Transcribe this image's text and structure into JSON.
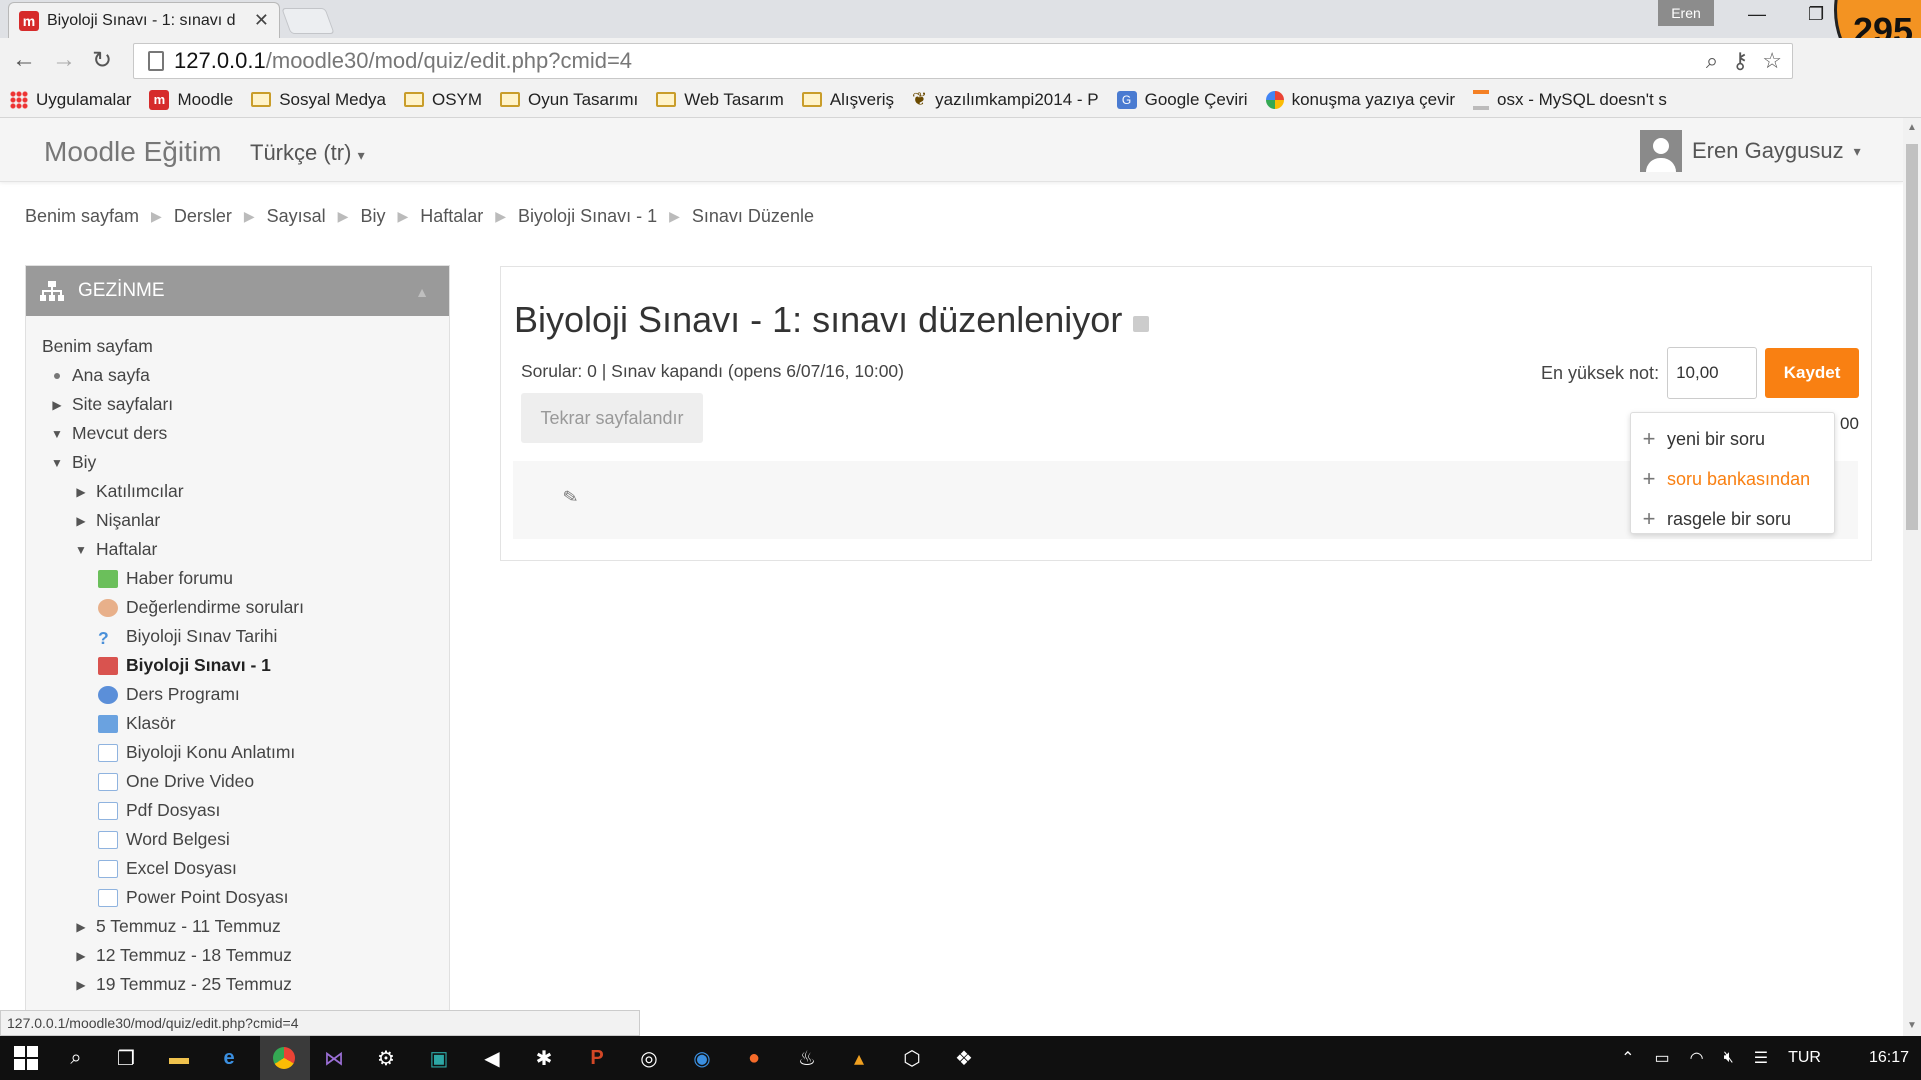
{
  "browser": {
    "tab_title": "Biyoloji Sınavı - 1: sınavı d",
    "tab_favicon": "m",
    "profile": "Eren",
    "counter": "295",
    "url_host": "127.0.0.1",
    "url_path": "/moodle30/mod/quiz/edit.php?cmid=4",
    "bookmarks": [
      {
        "label": "Uygulamalar",
        "icon": "apps-icon"
      },
      {
        "label": "Moodle",
        "icon": "moodle-icon"
      },
      {
        "label": "Sosyal Medya",
        "icon": "folder-icon"
      },
      {
        "label": "OSYM",
        "icon": "folder-icon"
      },
      {
        "label": "Oyun Tasarımı",
        "icon": "folder-icon"
      },
      {
        "label": "Web Tasarım",
        "icon": "folder-icon"
      },
      {
        "label": "Alışveriş",
        "icon": "folder-icon"
      },
      {
        "label": "yazılımkampi2014 - P",
        "icon": "bookmark-icon"
      },
      {
        "label": "Google Çeviri",
        "icon": "translate-icon"
      },
      {
        "label": "konuşma yazıya çevir",
        "icon": "chrome-icon"
      },
      {
        "label": "osx - MySQL doesn't s",
        "icon": "stackoverflow-icon"
      }
    ],
    "status_url": "127.0.0.1/moodle30/mod/quiz/edit.php?cmid=4"
  },
  "navbar": {
    "brand": "Moodle Eğitim",
    "language": "Türkçe (tr)",
    "user": "Eren Gaygusuz"
  },
  "breadcrumb": [
    "Benim sayfam",
    "Dersler",
    "Sayısal",
    "Biy",
    "Haftalar",
    "Biyoloji Sınavı - 1",
    "Sınavı Düzenle"
  ],
  "navigation": {
    "title": "GEZİNME",
    "items": [
      {
        "label": "Benim sayfam",
        "level": 0,
        "toggle": "",
        "icon": ""
      },
      {
        "label": "Ana sayfa",
        "level": 1,
        "toggle": "dot",
        "icon": ""
      },
      {
        "label": "Site sayfaları",
        "level": 1,
        "toggle": "▶",
        "icon": ""
      },
      {
        "label": "Mevcut ders",
        "level": 1,
        "toggle": "▼",
        "icon": ""
      },
      {
        "label": "Biy",
        "level": 2,
        "toggle": "▼",
        "icon": ""
      },
      {
        "label": "Katılımcılar",
        "level": 3,
        "toggle": "▶",
        "icon": ""
      },
      {
        "label": "Nişanlar",
        "level": 3,
        "toggle": "▶",
        "icon": ""
      },
      {
        "label": "Haftalar",
        "level": 3,
        "toggle": "▼",
        "icon": ""
      },
      {
        "label": "Haber forumu",
        "level": 4,
        "toggle": "",
        "icon": "forum-icon"
      },
      {
        "label": "Değerlendirme soruları",
        "level": 4,
        "toggle": "",
        "icon": "feedback-icon"
      },
      {
        "label": "Biyoloji Sınav Tarihi",
        "level": 4,
        "toggle": "",
        "icon": "choice-icon"
      },
      {
        "label": "Biyoloji Sınavı - 1",
        "level": 4,
        "toggle": "",
        "icon": "quiz-icon",
        "current": true
      },
      {
        "label": "Ders Programı",
        "level": 4,
        "toggle": "",
        "icon": "chat-icon"
      },
      {
        "label": "Klasör",
        "level": 4,
        "toggle": "",
        "icon": "folder-icon"
      },
      {
        "label": "Biyoloji Konu Anlatımı",
        "level": 4,
        "toggle": "",
        "icon": "file-icon"
      },
      {
        "label": "One Drive Video",
        "level": 4,
        "toggle": "",
        "icon": "file-icon"
      },
      {
        "label": "Pdf Dosyası",
        "level": 4,
        "toggle": "",
        "icon": "file-icon"
      },
      {
        "label": "Word Belgesi",
        "level": 4,
        "toggle": "",
        "icon": "file-icon"
      },
      {
        "label": "Excel Dosyası",
        "level": 4,
        "toggle": "",
        "icon": "file-icon"
      },
      {
        "label": "Power Point Dosyası",
        "level": 4,
        "toggle": "",
        "icon": "file-icon"
      },
      {
        "label": "5 Temmuz - 11 Temmuz",
        "level": 3,
        "toggle": "▶",
        "icon": ""
      },
      {
        "label": "12 Temmuz - 18 Temmuz",
        "level": 3,
        "toggle": "▶",
        "icon": ""
      },
      {
        "label": "19 Temmuz - 25 Temmuz",
        "level": 3,
        "toggle": "▶",
        "icon": ""
      }
    ]
  },
  "quiz": {
    "title": "Biyoloji Sınavı - 1: sınavı düzenleniyor",
    "status": "Sorular: 0 | Sınav kapandı (opens 6/07/16, 10:00)",
    "repaginate": "Tekrar sayfalandır",
    "max_grade_label": "En yüksek not:",
    "max_grade_value": "10,00",
    "save": "Kaydet",
    "total_marks": "00"
  },
  "add_menu": [
    {
      "label": "yeni bir soru",
      "active": false
    },
    {
      "label": "soru bankasından",
      "active": true
    },
    {
      "label": "rasgele bir soru",
      "active": false
    }
  ],
  "taskbar": {
    "language": "TUR",
    "time": "16:17"
  },
  "colors": {
    "accent": "#f98012",
    "nav_header": "#9a9a9a"
  }
}
